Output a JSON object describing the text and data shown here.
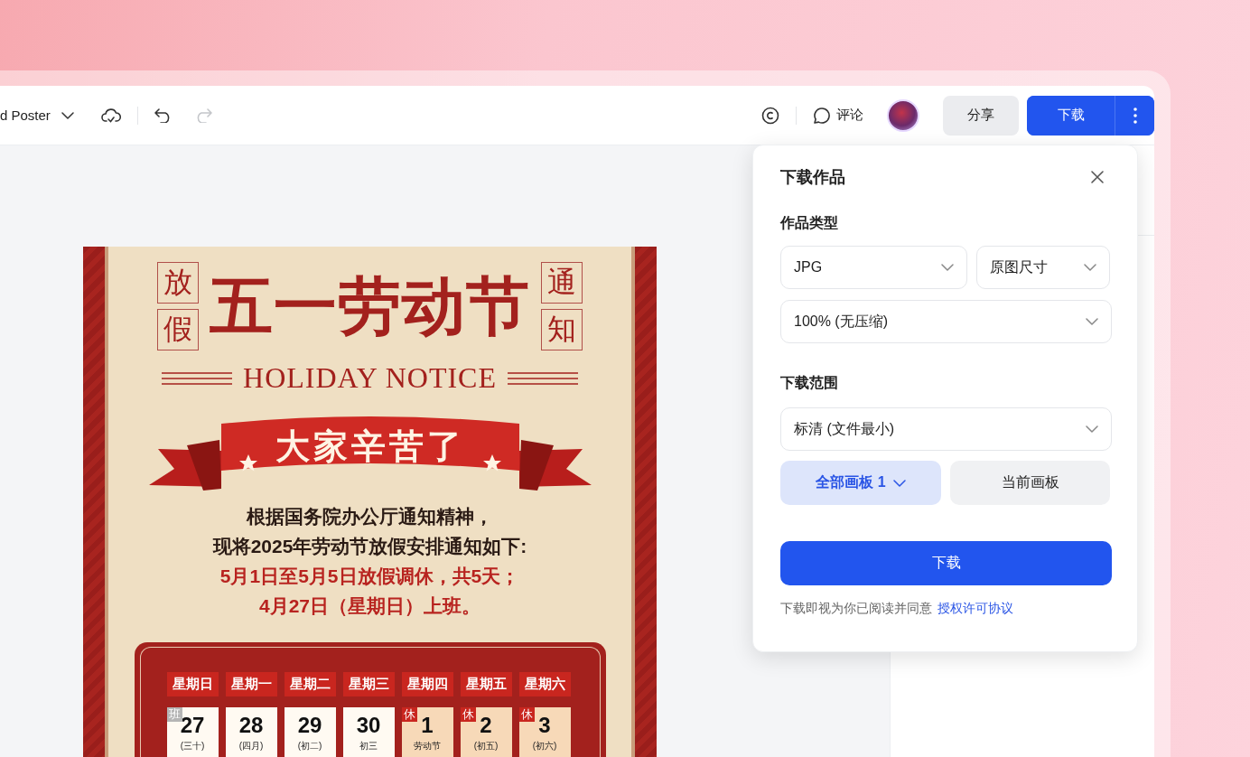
{
  "toolbar": {
    "file_name": "d Poster",
    "undo": {
      "disabled": false
    },
    "redo": {
      "disabled": true
    },
    "comment_label": "评论",
    "share_label": "分享",
    "download_label": "下载"
  },
  "poster": {
    "side_left": [
      "放",
      "假"
    ],
    "title": "五一劳动节",
    "side_right": [
      "通",
      "知"
    ],
    "subtitle": "HOLIDAY NOTICE",
    "ribbon": "大家辛苦了",
    "lines": [
      {
        "text": "根据国务院办公厅通知精神，",
        "kind": "plain"
      },
      {
        "text": "现将2025年劳动节放假安排通知如下:",
        "kind": "plain"
      },
      {
        "text": "5月1日至5月5日放假调休，共5天；",
        "kind": "highlight"
      },
      {
        "text": "4月27日（星期日）上班。",
        "kind": "highlight"
      }
    ],
    "weekdays": [
      "星期日",
      "星期一",
      "星期二",
      "星期三",
      "星期四",
      "星期五",
      "星期六"
    ],
    "days": [
      {
        "day": "27",
        "note": "(三十)",
        "tag": "班",
        "kind": "work"
      },
      {
        "day": "28",
        "note": "(四月)",
        "kind": "normal"
      },
      {
        "day": "29",
        "note": "(初二)",
        "kind": "normal"
      },
      {
        "day": "30",
        "note": "初三",
        "kind": "normal"
      },
      {
        "day": "1",
        "note": "劳动节",
        "tag": "休",
        "kind": "rest"
      },
      {
        "day": "2",
        "note": "(初五)",
        "tag": "休",
        "kind": "rest"
      },
      {
        "day": "3",
        "note": "(初六)",
        "tag": "休",
        "kind": "rest"
      }
    ]
  },
  "dialog": {
    "title": "下载作品",
    "type_heading": "作品类型",
    "format": "JPG",
    "size": "原图尺寸",
    "quality": "100% (无压缩)",
    "range_heading": "下载范围",
    "resolution": "标清 (文件最小)",
    "range_options": [
      {
        "label": "全部画板 1",
        "selected": true
      },
      {
        "label": "当前画板",
        "selected": false
      }
    ],
    "download_button": "下载",
    "agreement_text": "下载即视为你已阅读并同意",
    "agreement_link": "授权许可协议"
  }
}
